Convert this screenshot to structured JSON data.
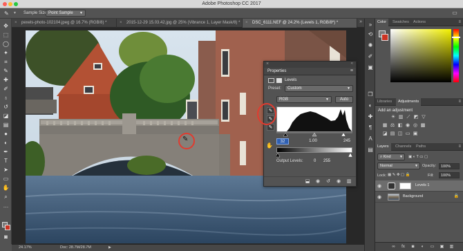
{
  "app": {
    "title": "Adobe Photoshop CC 2017"
  },
  "options_bar": {
    "sample_size_label": "Sample Size:",
    "sample_size_value": "Point Sample"
  },
  "doc_tabs": [
    {
      "label": "pexels-photo-102104.jpeg @ 16.7% (RGB/8) *"
    },
    {
      "label": "2015-12-29 15.03.42.jpg @ 25% (Vibrance 1, Layer Mask/8) *"
    },
    {
      "label": "DSC_6111.NEF @ 24.2% (Levels 1, RGB/8*) *"
    }
  ],
  "status": {
    "zoom": "24.17%",
    "doc": "Doc: 28.7M/28.7M"
  },
  "properties": {
    "title": "Properties",
    "adjustment": "Levels",
    "preset_label": "Preset:",
    "preset_value": "Custom",
    "channel_value": "RGB",
    "auto_label": "Auto",
    "input_black": "32",
    "input_gamma": "1.00",
    "input_white": "245",
    "output_label": "Output Levels:",
    "output_black": "0",
    "output_white": "255"
  },
  "right_panel": {
    "tabs_top": [
      "Color",
      "Swatches",
      "Actions"
    ],
    "tabs_mid": [
      "Libraries",
      "Adjustments"
    ],
    "add_adjustment": "Add an adjustment",
    "tabs_layers": [
      "Layers",
      "Channels",
      "Paths"
    ],
    "kind_label": "Kind",
    "blend_mode": "Normal",
    "opacity_label": "Opacity:",
    "opacity_value": "100%",
    "lock_label": "Lock:",
    "fill_label": "Fill:",
    "fill_value": "100%",
    "layers": [
      {
        "name": "Levels 1"
      },
      {
        "name": "Background"
      }
    ]
  },
  "colors": {
    "accent_ring": "#e13b2f",
    "foreground": "#7a7a7a",
    "background": "#cc3322"
  }
}
